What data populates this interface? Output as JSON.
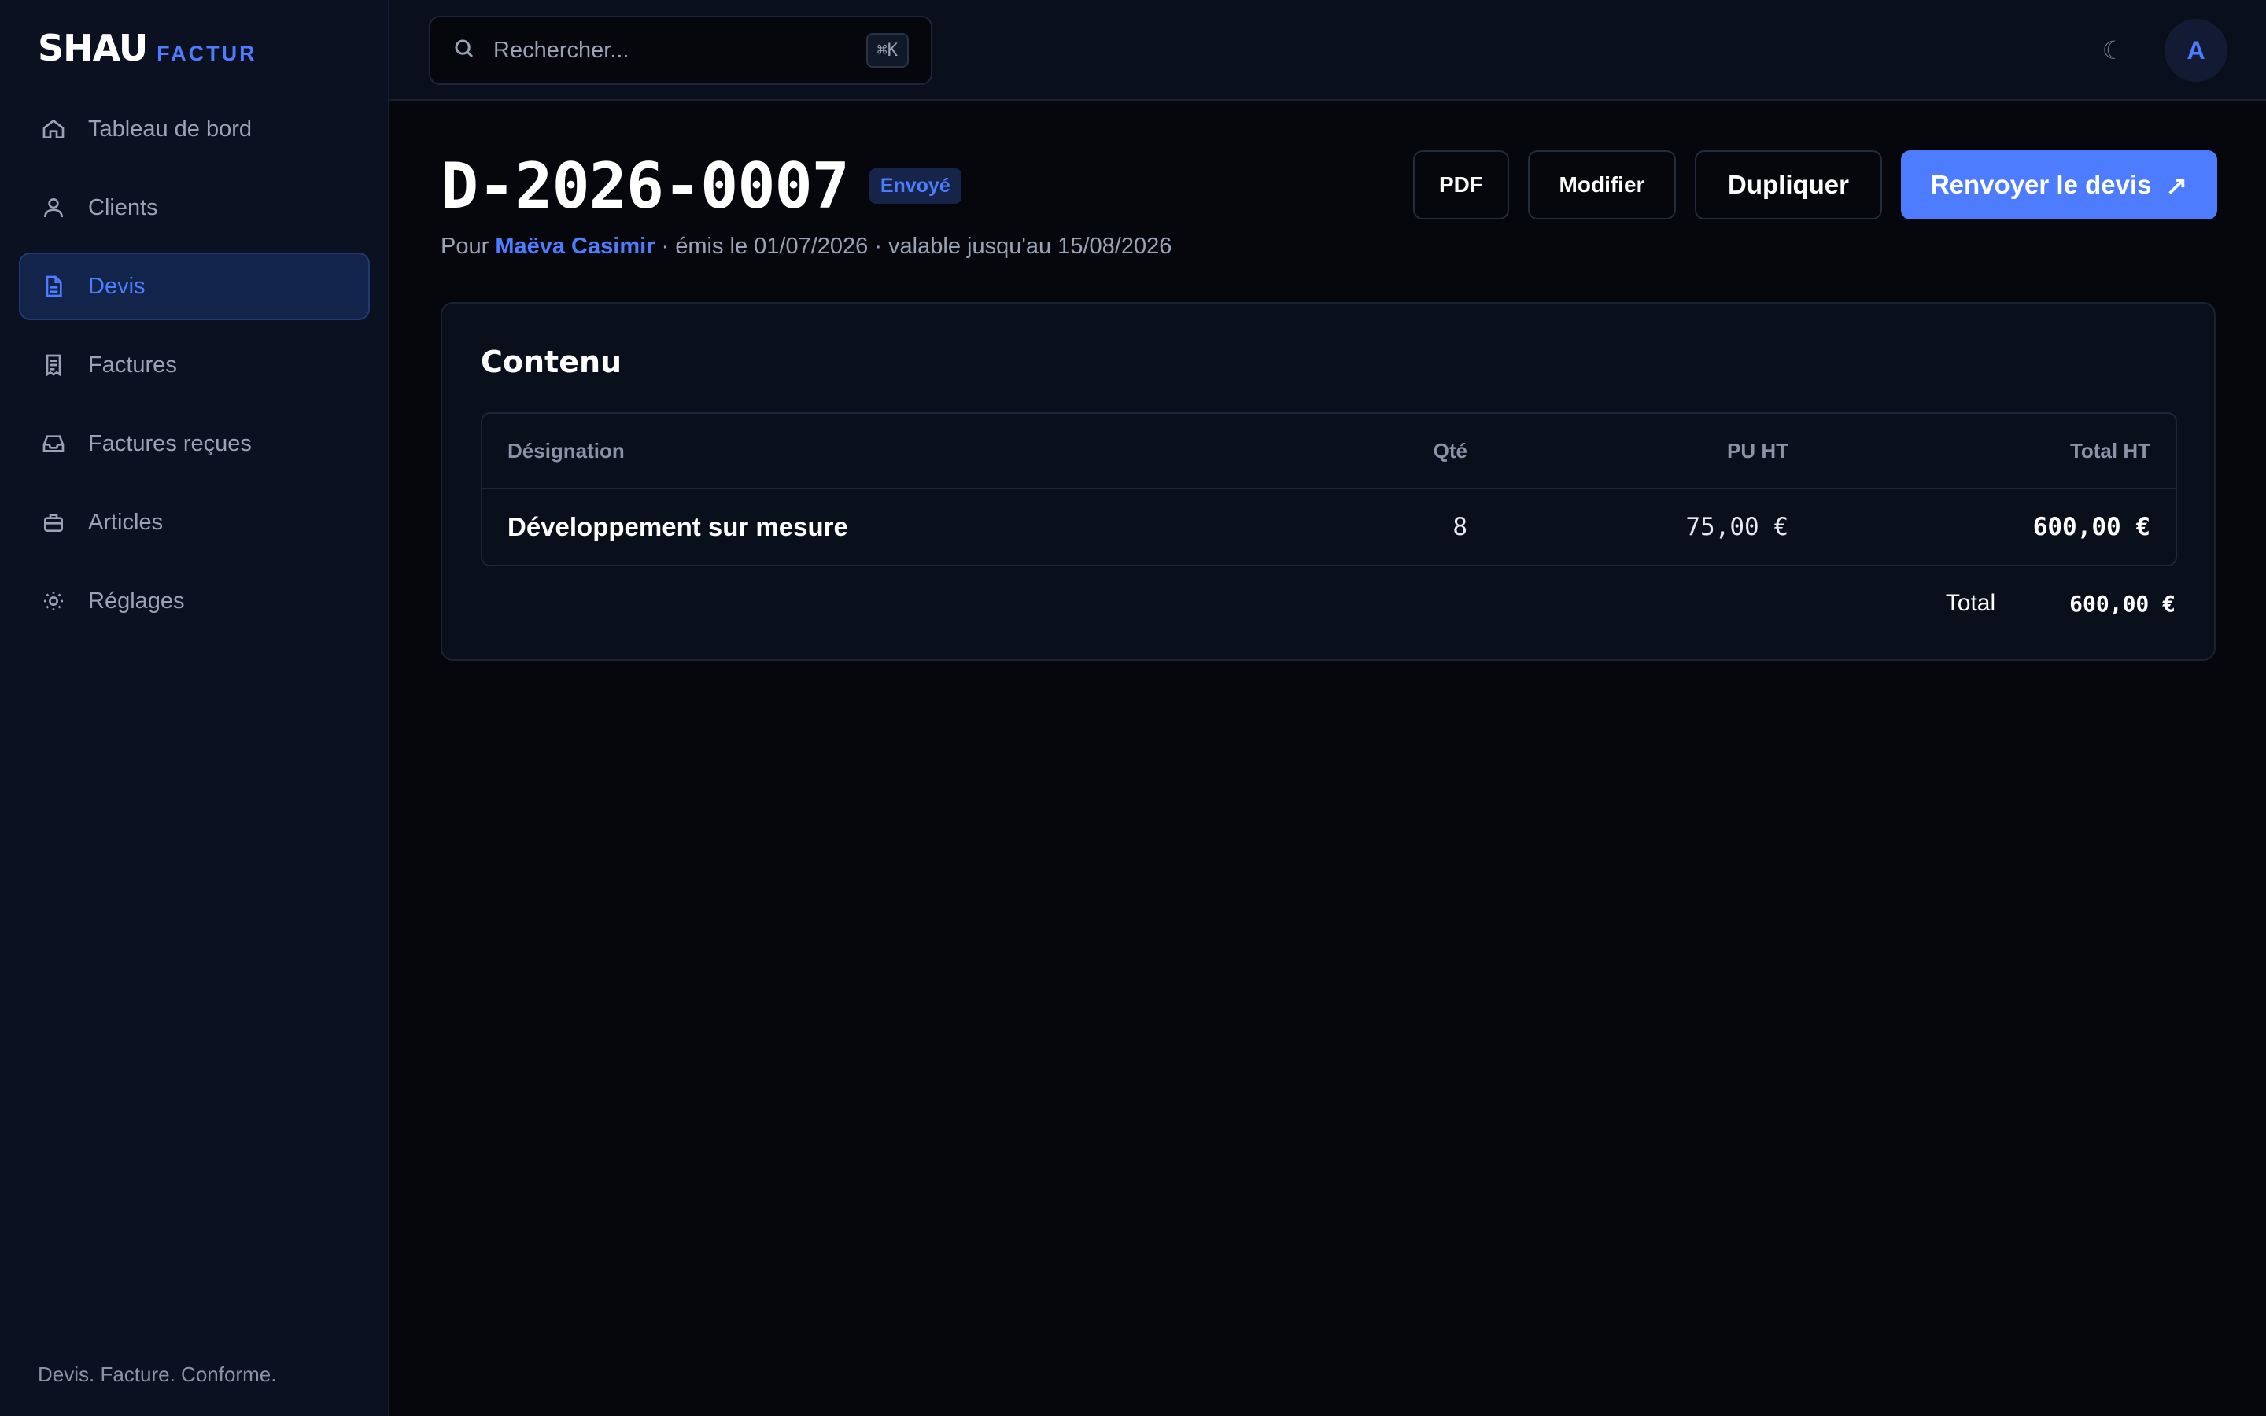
{
  "brand": {
    "name": "SHAU",
    "sub": "FACTUR"
  },
  "sidebar": {
    "items": [
      {
        "label": "Tableau de bord",
        "icon": "home-icon"
      },
      {
        "label": "Clients",
        "icon": "user-icon"
      },
      {
        "label": "Devis",
        "icon": "document-icon",
        "active": true
      },
      {
        "label": "Factures",
        "icon": "receipt-icon"
      },
      {
        "label": "Factures reçues",
        "icon": "inbox-icon"
      },
      {
        "label": "Articles",
        "icon": "briefcase-icon"
      },
      {
        "label": "Réglages",
        "icon": "sun-gear-icon"
      }
    ],
    "tagline": "Devis. Facture. Conforme."
  },
  "topbar": {
    "search": {
      "placeholder": "Rechercher...",
      "value": "",
      "shortcut": "⌘K"
    },
    "theme_icon": "☾",
    "avatar": "A"
  },
  "quote": {
    "number": "D-2026-0007",
    "status": "Envoyé",
    "subtitle_prefix": "Pour",
    "client": "Maëva Casimir",
    "subtitle_rest": " · émis le 01/07/2026 · valable jusqu'au 15/08/2026"
  },
  "actions": {
    "pdf": "PDF",
    "edit": "Modifier",
    "duplicate": "Dupliquer",
    "resend": "Renvoyer le devis",
    "resend_icon": "↗"
  },
  "content": {
    "title": "Contenu",
    "columns": {
      "designation": "Désignation",
      "qty": "Qté",
      "unit_price": "PU HT",
      "total": "Total HT"
    },
    "rows": [
      {
        "designation": "Développement sur mesure",
        "qty": "8",
        "unit_price": "75,00 €",
        "total": "600,00 €"
      }
    ],
    "total_label": "Total",
    "total_value": "600,00 €"
  },
  "colors": {
    "accent": "#4d7cfe",
    "background": "#05070d",
    "sidebar": "#0b1120"
  }
}
